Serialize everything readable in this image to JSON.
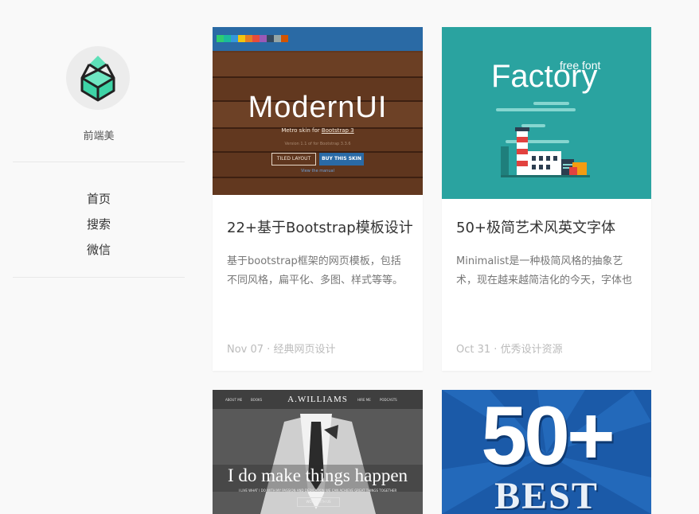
{
  "site": {
    "name": "前端美",
    "logo_icon": "gem-hex-logo-icon",
    "accent": "#2fd1a0"
  },
  "nav": {
    "items": [
      {
        "label": "首页"
      },
      {
        "label": "搜索"
      },
      {
        "label": "微信"
      }
    ]
  },
  "posts": [
    {
      "title": "22+基于Bootstrap模板设计",
      "excerpt": "基于bootstrap框架的网页模板，包括不同风格，扁平化、多图、样式等等。",
      "date": "Nov 07",
      "category": "经典网页设计",
      "thumb": {
        "heading": "ModernUI",
        "sub_prefix": "Metro skin for ",
        "sub_link": "Bootstrap 3",
        "version": "Version 1.1 of for Bootstrap 3.3.6",
        "btn_tiled": "TILED LAYOUT",
        "btn_buy": "BUY THIS SKIN",
        "view_link": "View the manual"
      }
    },
    {
      "title": "50+极简艺术风英文字体",
      "excerpt": "Minimalist是一种极简风格的抽象艺术，现在越来越简洁化的今天，字体也",
      "date": "Oct 31",
      "category": "优秀设计资源",
      "thumb": {
        "heading": "Factory",
        "sub": "free font"
      }
    },
    {
      "thumb": {
        "nav": [
          "ABOUT ME",
          "BOOKS",
          "",
          "A.WILLIAMS",
          "HIRE ME",
          "PODCASTS"
        ],
        "brand": "A.WILLIAMS",
        "headline": "I do make things happen",
        "tagline": "I LIVE WHAT I DO WITH MY PASSION AND DEDICATION WE CAN ACHIEVE GREAT THINGS TOGETHER",
        "button": "WORK WITH US"
      }
    },
    {
      "thumb": {
        "big": "50+",
        "sub": "BEST"
      }
    }
  ]
}
